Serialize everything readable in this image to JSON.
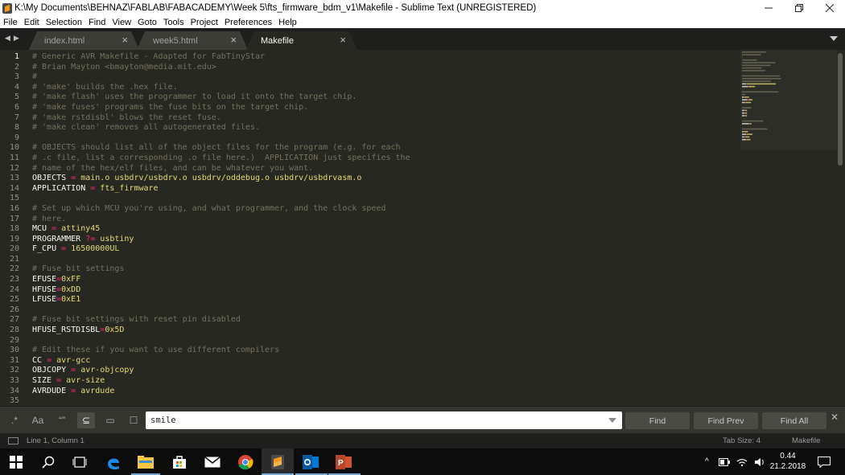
{
  "window": {
    "title": "K:\\My Documents\\BEHNAZ\\FABLAB\\FABACADEMY\\Week 5\\fts_firmware_bdm_v1\\Makefile - Sublime Text (UNREGISTERED)",
    "controls": [
      "minimize-icon",
      "maximize-icon",
      "close-icon"
    ]
  },
  "menu": [
    "File",
    "Edit",
    "Selection",
    "Find",
    "View",
    "Goto",
    "Tools",
    "Project",
    "Preferences",
    "Help"
  ],
  "tabs": [
    {
      "label": "index.html",
      "active": false
    },
    {
      "label": "week5.html",
      "active": false
    },
    {
      "label": "Makefile",
      "active": true
    }
  ],
  "editor": {
    "lines": [
      {
        "n": "1",
        "t": [
          [
            "cm",
            "# Generic AVR Makefile - Adapted for FabTinyStar"
          ]
        ]
      },
      {
        "n": "2",
        "t": [
          [
            "cm",
            "# Brian Mayton <bmayton@media.mit.edu>"
          ]
        ]
      },
      {
        "n": "3",
        "t": [
          [
            "cm",
            "#"
          ]
        ]
      },
      {
        "n": "4",
        "t": [
          [
            "cm",
            "# 'make' builds the .hex file."
          ]
        ]
      },
      {
        "n": "5",
        "t": [
          [
            "cm",
            "# 'make flash' uses the programmer to load it onto the target chip."
          ]
        ]
      },
      {
        "n": "6",
        "t": [
          [
            "cm",
            "# 'make fuses' programs the fuse bits on the target chip."
          ]
        ]
      },
      {
        "n": "7",
        "t": [
          [
            "cm",
            "# 'make rstdisbl' blows the reset fuse."
          ]
        ]
      },
      {
        "n": "8",
        "t": [
          [
            "cm",
            "# 'make clean' removes all autogenerated files."
          ]
        ]
      },
      {
        "n": "9",
        "t": []
      },
      {
        "n": "10",
        "t": [
          [
            "cm",
            "# OBJECTS should list all of the object files for the program (e.g. for each"
          ]
        ]
      },
      {
        "n": "11",
        "t": [
          [
            "cm",
            "# .c file, list a corresponding .o file here.)  APPLICATION just specifies the"
          ]
        ]
      },
      {
        "n": "12",
        "t": [
          [
            "cm",
            "# name of the hex/elf files, and can be whatever you want."
          ]
        ]
      },
      {
        "n": "13",
        "t": [
          [
            "id",
            "OBJECTS "
          ],
          [
            "op",
            "="
          ],
          [
            "vl",
            " main.o usbdrv/usbdrv.o usbdrv/oddebug.o usbdrv/usbdrvasm.o"
          ]
        ]
      },
      {
        "n": "14",
        "t": [
          [
            "id",
            "APPLICATION "
          ],
          [
            "op",
            "="
          ],
          [
            "vl",
            " fts_firmware"
          ]
        ]
      },
      {
        "n": "15",
        "t": []
      },
      {
        "n": "16",
        "t": [
          [
            "cm",
            "# Set up which MCU you're using, and what programmer, and the clock speed"
          ]
        ]
      },
      {
        "n": "17",
        "t": [
          [
            "cm",
            "# here."
          ]
        ]
      },
      {
        "n": "18",
        "t": [
          [
            "id",
            "MCU "
          ],
          [
            "op",
            "="
          ],
          [
            "vl",
            " attiny45"
          ]
        ]
      },
      {
        "n": "19",
        "t": [
          [
            "id",
            "PROGRAMMER "
          ],
          [
            "op",
            "?="
          ],
          [
            "vl",
            " usbtiny"
          ]
        ]
      },
      {
        "n": "20",
        "t": [
          [
            "id",
            "F_CPU "
          ],
          [
            "op",
            "="
          ],
          [
            "vl",
            " 16500000UL"
          ]
        ]
      },
      {
        "n": "21",
        "t": []
      },
      {
        "n": "22",
        "t": [
          [
            "cm",
            "# Fuse bit settings"
          ]
        ]
      },
      {
        "n": "23",
        "t": [
          [
            "id",
            "EFUSE"
          ],
          [
            "op",
            "="
          ],
          [
            "vl",
            "0xFF"
          ]
        ]
      },
      {
        "n": "24",
        "t": [
          [
            "id",
            "HFUSE"
          ],
          [
            "op",
            "="
          ],
          [
            "vl",
            "0xDD"
          ]
        ]
      },
      {
        "n": "25",
        "t": [
          [
            "id",
            "LFUSE"
          ],
          [
            "op",
            "="
          ],
          [
            "vl",
            "0xE1"
          ]
        ]
      },
      {
        "n": "26",
        "t": []
      },
      {
        "n": "27",
        "t": [
          [
            "cm",
            "# Fuse bit settings with reset pin disabled"
          ]
        ]
      },
      {
        "n": "28",
        "t": [
          [
            "id",
            "HFUSE_RSTDISBL"
          ],
          [
            "op",
            "="
          ],
          [
            "vl",
            "0x5D"
          ]
        ]
      },
      {
        "n": "29",
        "t": []
      },
      {
        "n": "30",
        "t": [
          [
            "cm",
            "# Edit these if you want to use different compilers"
          ]
        ]
      },
      {
        "n": "31",
        "t": [
          [
            "id",
            "CC "
          ],
          [
            "op",
            "="
          ],
          [
            "vl",
            " avr-gcc"
          ]
        ]
      },
      {
        "n": "32",
        "t": [
          [
            "id",
            "OBJCOPY "
          ],
          [
            "op",
            "="
          ],
          [
            "vl",
            " avr-objcopy"
          ]
        ]
      },
      {
        "n": "33",
        "t": [
          [
            "id",
            "SIZE "
          ],
          [
            "op",
            "="
          ],
          [
            "vl",
            " avr-size"
          ]
        ]
      },
      {
        "n": "34",
        "t": [
          [
            "id",
            "AVRDUDE "
          ],
          [
            "op",
            "="
          ],
          [
            "vl",
            " avrdude"
          ]
        ]
      },
      {
        "n": "35",
        "t": []
      }
    ],
    "syntax_colors": {
      "comment": "#75715e",
      "identifier": "#f8f8f2",
      "operator": "#f92672",
      "value": "#e6db74",
      "background": "#272822"
    }
  },
  "find_panel": {
    "options": [
      ".*",
      "Aa",
      "“”",
      "⊆",
      "▭",
      "☐"
    ],
    "query": "smile",
    "buttons": {
      "find": "Find",
      "find_prev": "Find Prev",
      "find_all": "Find All"
    }
  },
  "status": {
    "position": "Line 1, Column 1",
    "tab_size": "Tab Size: 4",
    "syntax": "Makefile"
  },
  "taskbar": {
    "apps": [
      "windows-start-icon",
      "search-icon",
      "task-view-icon",
      "edge-icon",
      "file-explorer-icon",
      "store-icon",
      "mail-icon",
      "chrome-icon",
      "sublime-text-icon",
      "outlook-icon",
      "powerpoint-icon"
    ],
    "time": "0.44",
    "date": "21.2.2018"
  }
}
